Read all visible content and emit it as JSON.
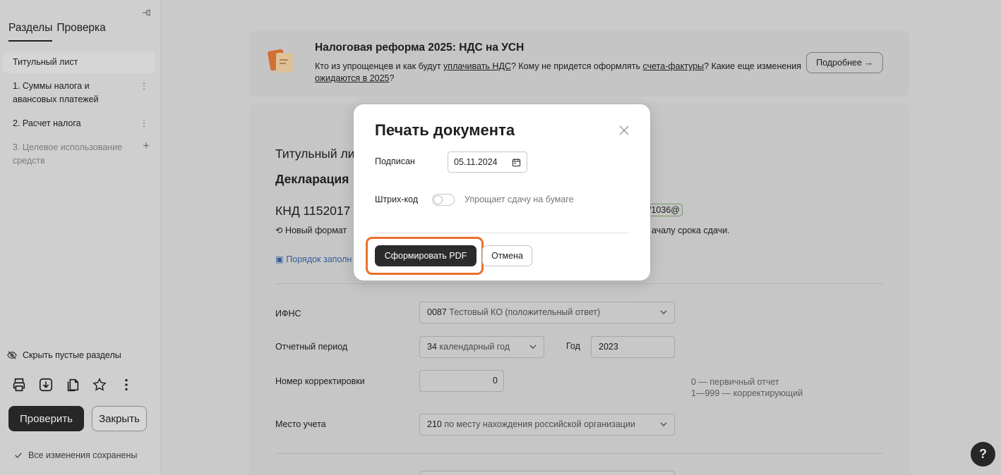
{
  "sidebar": {
    "tabs": [
      "Разделы",
      "Проверка"
    ],
    "items": [
      {
        "label": "Титульный лист"
      },
      {
        "label": "1. Суммы налога и авансовых платежей"
      },
      {
        "label": "2. Расчет налога"
      },
      {
        "label": "3. Целевое использование средств"
      }
    ],
    "hide_empty_label": "Скрыть пустые разделы",
    "check_button": "Проверить",
    "close_button": "Закрыть",
    "saved_status": "Все изменения сохранены",
    "icons": [
      "pin-icon",
      "eye-off-icon",
      "print-icon",
      "download-icon",
      "copy-icon",
      "star-icon",
      "more-vertical-icon",
      "check-icon"
    ]
  },
  "banner": {
    "title": "Налоговая реформа 2025: НДС на УСН",
    "text_1": "Кто из упрощенцев и как будут ",
    "link_1": "уплачивать НДС",
    "text_2": "? Кому не придется оформлять ",
    "link_2": "счета-фактуры",
    "text_3": "? Какие еще изменения ",
    "link_3": "ожидаются в 2025",
    "text_4": "?",
    "more_button": "Подробнее →"
  },
  "form": {
    "title_partial": "Титульный ли",
    "decl_partial": "Декларация",
    "knd_partial": "КНД 1152017",
    "order_badge_partial": "/1036@",
    "new_format_partial": "Новый формат",
    "deadline_partial": "ачалу срока сдачи.",
    "fill_order_partial": "Порядок заполн",
    "ifns": {
      "label": "ИФНС",
      "code": "0087",
      "value": "Тестовый КО (положительный ответ)"
    },
    "period": {
      "label": "Отчетный период",
      "code": "34",
      "value": "календарный год",
      "year_label": "Год",
      "year": "2023"
    },
    "correction": {
      "label": "Номер корректировки",
      "value": "0",
      "hint_1": "0 — первичный отчет",
      "hint_2": "1—999 — корректирующий"
    },
    "location": {
      "label": "Место учета",
      "code": "210",
      "value": "по месту нахождения российской организации"
    }
  },
  "modal": {
    "title": "Печать документа",
    "signed_label": "Подписан",
    "signed_date": "05.11.2024",
    "barcode_label": "Штрих-код",
    "barcode_enabled": false,
    "barcode_hint": "Упрощает сдачу на бумаге",
    "generate_button": "Сформировать PDF",
    "cancel_button": "Отмена"
  },
  "help": {
    "label": "?"
  },
  "colors": {
    "accent_highlight": "#e9702e",
    "primary_button": "#2b2b2b",
    "link": "#3a68a8"
  }
}
